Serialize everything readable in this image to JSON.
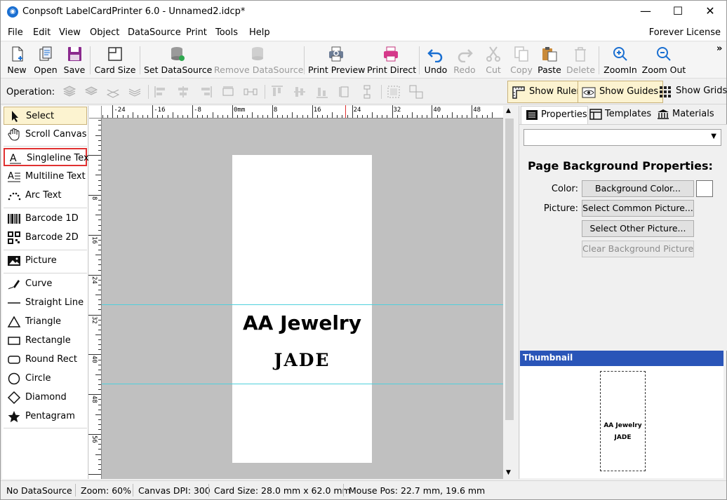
{
  "window": {
    "title": "Conpsoft LabelCardPrinter 6.0 - Unnamed2.idcp*",
    "minimize": "—",
    "maximize": "☐",
    "close": "✕"
  },
  "menu": {
    "items": [
      "File",
      "Edit",
      "View",
      "Object",
      "DataSource",
      "Print",
      "Tools",
      "Help"
    ],
    "license": "Forever License"
  },
  "toolbar": {
    "new": "New",
    "open": "Open",
    "save": "Save",
    "card_size": "Card Size",
    "set_datasource": "Set DataSource",
    "remove_datasource": "Remove DataSource",
    "print_preview": "Print Preview",
    "print_direct": "Print Direct",
    "undo": "Undo",
    "redo": "Redo",
    "cut": "Cut",
    "copy": "Copy",
    "paste": "Paste",
    "delete": "Delete",
    "zoom_in": "ZoomIn",
    "zoom_out": "Zoom Out",
    "overflow": "»"
  },
  "operation": {
    "label": "Operation:",
    "show_ruler": "Show Ruler",
    "show_guides": "Show Guides",
    "show_grids": "Show Grids"
  },
  "palette": {
    "select": "Select",
    "scroll_canvas": "Scroll Canvas",
    "singleline_text": "Singleline Text",
    "multiline_text": "Multiline Text",
    "arc_text": "Arc Text",
    "barcode_1d": "Barcode 1D",
    "barcode_2d": "Barcode 2D",
    "picture": "Picture",
    "curve": "Curve",
    "straight_line": "Straight Line",
    "triangle": "Triangle",
    "rectangle": "Rectangle",
    "round_rect": "Round Rect",
    "circle": "Circle",
    "diamond": "Diamond",
    "pentagram": "Pentagram"
  },
  "ruler": {
    "h_labels": [
      "-24",
      "-16",
      "-8",
      "0mm",
      "8",
      "16",
      "24",
      "32",
      "40",
      "48"
    ],
    "v_labels": [
      "8",
      "16",
      "24",
      "32",
      "40",
      "48",
      "56"
    ]
  },
  "canvas": {
    "text1": "AA Jewelry",
    "text2": "JADE"
  },
  "right_panel": {
    "tabs": [
      "Properties",
      "Templates",
      "Materials"
    ],
    "heading": "Page Background Properties:",
    "color_label": "Color:",
    "background_color_btn": "Background Color...",
    "picture_label": "Picture:",
    "select_common_btn": "Select Common Picture...",
    "select_other_btn": "Select Other Picture...",
    "clear_bg_btn": "Clear Background Picture",
    "thumbnail_title": "Thumbnail",
    "swatch_color": "#ffffff"
  },
  "status": {
    "datasource": "No DataSource",
    "zoom": "Zoom: 60%",
    "dpi": "Canvas DPI: 300",
    "card_size": "Card Size: 28.0 mm x 62.0 mm",
    "mouse_pos": "Mouse Pos: 22.7 mm, 19.6 mm"
  }
}
